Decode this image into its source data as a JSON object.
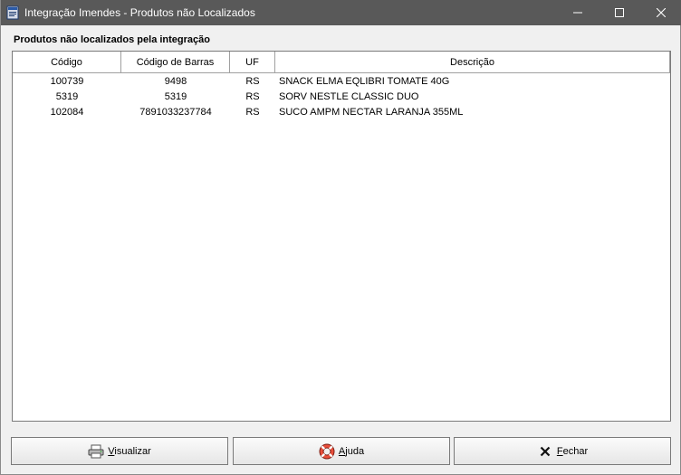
{
  "window": {
    "title": "Integração Imendes - Produtos não Localizados",
    "titlebar_color": "#595959"
  },
  "section": {
    "label": "Produtos não localizados pela integração"
  },
  "grid": {
    "columns": [
      "Código",
      "Código de Barras",
      "UF",
      "Descrição"
    ],
    "rows": [
      {
        "codigo": "100739",
        "barras": "9498",
        "uf": "RS",
        "descricao": "SNACK ELMA  EQLIBRI TOMATE 40G"
      },
      {
        "codigo": "5319",
        "barras": "5319",
        "uf": "RS",
        "descricao": "SORV NESTLE CLASSIC DUO"
      },
      {
        "codigo": "102084",
        "barras": "7891033237784",
        "uf": "RS",
        "descricao": "SUCO AMPM NECTAR LARANJA 355ML"
      }
    ]
  },
  "buttons": {
    "visualizar": {
      "accel": "V",
      "rest": "isualizar",
      "icon": "printer-icon"
    },
    "ajuda": {
      "accel": "A",
      "rest": "juda",
      "icon": "lifebuoy-icon"
    },
    "fechar": {
      "accel": "F",
      "rest": "echar",
      "icon": "close-x-icon"
    }
  }
}
